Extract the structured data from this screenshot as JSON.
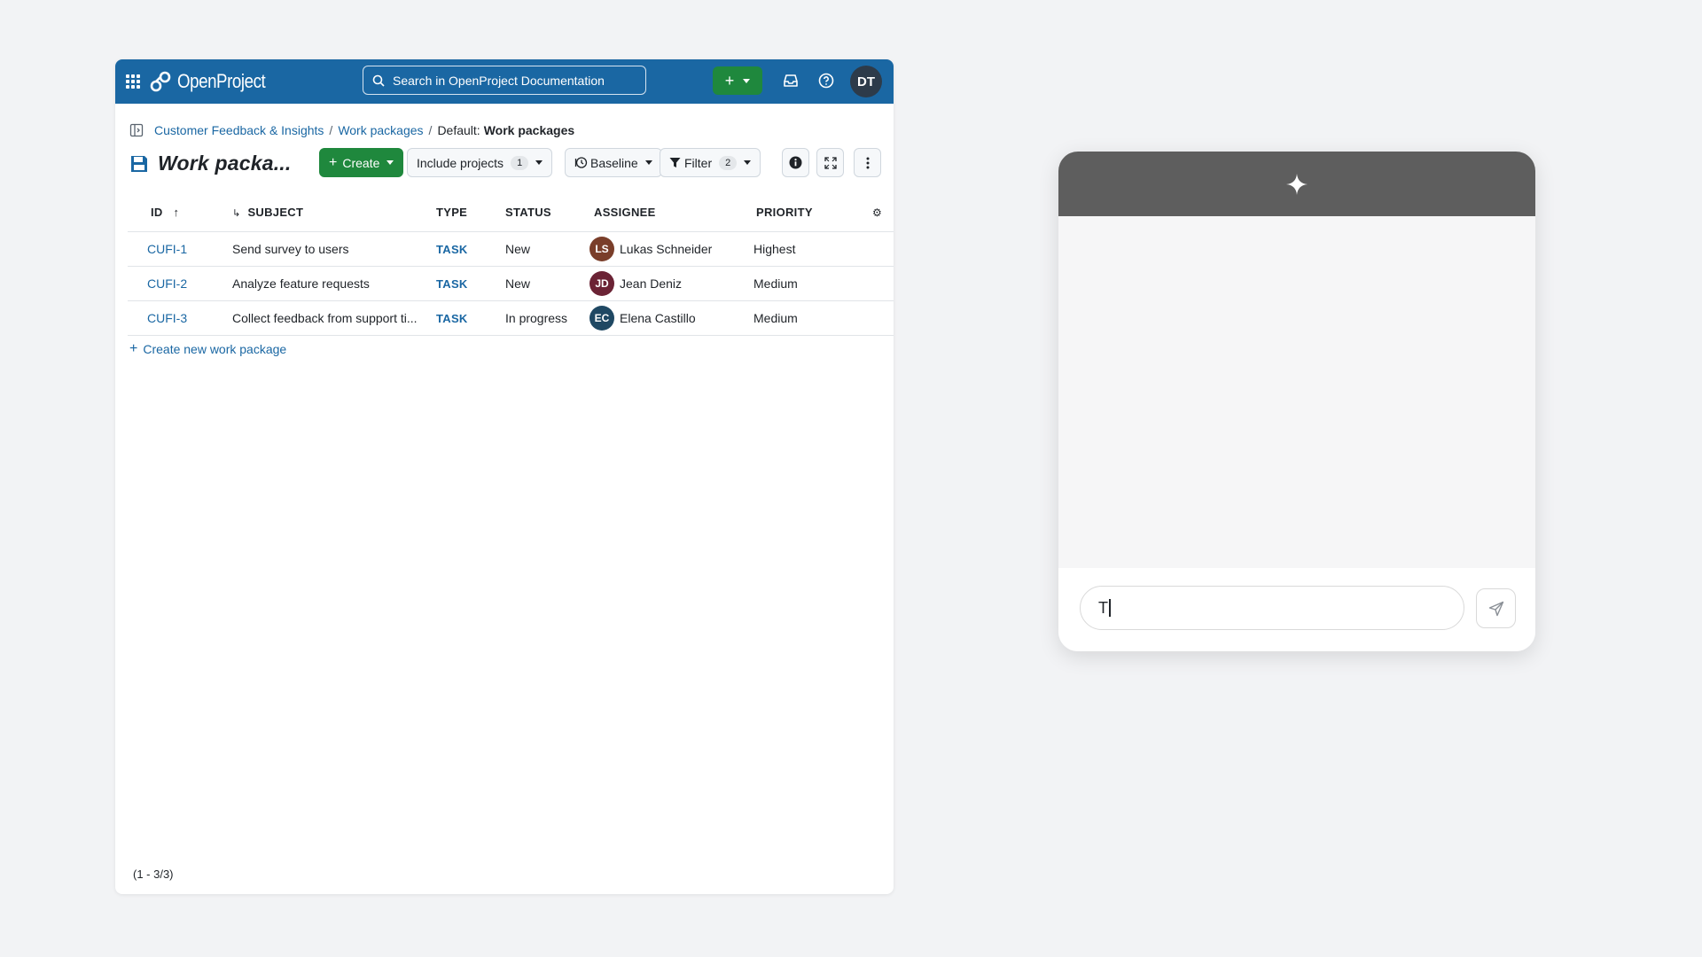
{
  "header": {
    "app_name": "OpenProject",
    "search_placeholder": "Search in OpenProject Documentation",
    "user_initials": "DT"
  },
  "breadcrumb": {
    "project": "Customer Feedback & Insights",
    "section": "Work packages",
    "current_prefix": "Default:",
    "current": "Work packages"
  },
  "toolbar": {
    "title": "Work packa...",
    "create_label": "Create",
    "include_projects_label": "Include projects",
    "include_projects_count": "1",
    "baseline_label": "Baseline",
    "filter_label": "Filter",
    "filter_count": "2"
  },
  "table": {
    "columns": [
      "ID",
      "SUBJECT",
      "TYPE",
      "STATUS",
      "ASSIGNEE",
      "PRIORITY"
    ],
    "rows": [
      {
        "id": "CUFI-1",
        "subject": "Send survey to users",
        "type": "TASK",
        "status": "New",
        "assignee": "Lukas Schneider",
        "initials": "LS",
        "avatar_color": "#7a3e2a",
        "priority": "Highest"
      },
      {
        "id": "CUFI-2",
        "subject": "Analyze feature requests",
        "type": "TASK",
        "status": "New",
        "assignee": "Jean Deniz",
        "initials": "JD",
        "avatar_color": "#6b2335",
        "priority": "Medium"
      },
      {
        "id": "CUFI-3",
        "subject": "Collect feedback from support ti...",
        "type": "TASK",
        "status": "In progress",
        "assignee": "Elena Castillo",
        "initials": "EC",
        "avatar_color": "#1f4863",
        "priority": "Medium"
      }
    ]
  },
  "create_new_label": "Create new work package",
  "pagination": "(1 - 3/3)",
  "chat": {
    "input_value": "T"
  },
  "colors": {
    "header_blue": "#1a67a3",
    "create_green": "#1f883d",
    "chat_header": "#5e5e5e"
  }
}
